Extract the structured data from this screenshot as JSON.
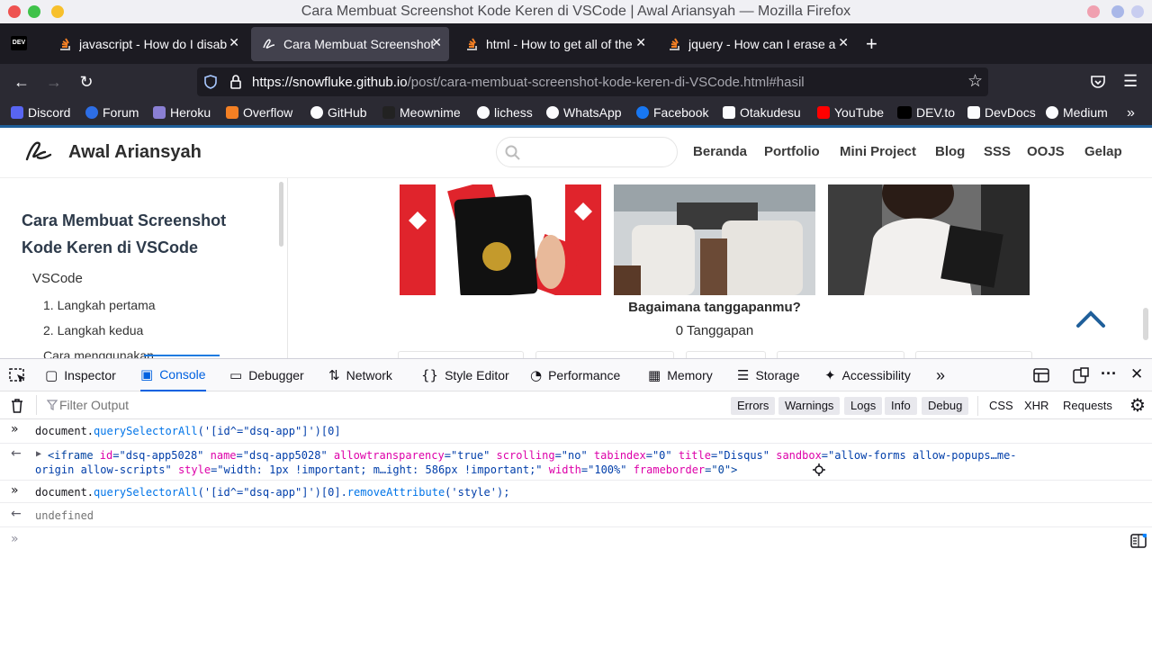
{
  "window": {
    "title": "Cara Membuat Screenshot Kode Keren di VSCode | Awal Ariansyah — Mozilla Firefox"
  },
  "tabs": [
    {
      "label": "javascript - How do I disab",
      "active": false
    },
    {
      "label": "Cara Membuat Screenshot Kod",
      "active": true
    },
    {
      "label": "html - How to get all of the",
      "active": false
    },
    {
      "label": "jquery - How can I erase a",
      "active": false
    }
  ],
  "url": {
    "host": "https://snowfluke.github.io",
    "path": "/post/cara-membuat-screenshot-kode-keren-di-VSCode.html#hasil"
  },
  "bookmarks": [
    "Discord",
    "Forum",
    "Heroku",
    "Overflow",
    "GitHub",
    "Meownime",
    "lichess",
    "WhatsApp",
    "Facebook",
    "Otakudesu",
    "YouTube",
    "DEV.to",
    "DevDocs",
    "Medium"
  ],
  "site": {
    "brand": "Awal Ariansyah",
    "menu": [
      "Beranda",
      "Portfolio",
      "Mini Project",
      "Blog",
      "SSS",
      "OOJS",
      "Gelap"
    ],
    "sidebar": {
      "title": "Cara Membuat Screenshot Kode Keren di VSCode",
      "items": [
        "VSCode",
        "1. Langkah pertama",
        "2. Langkah kedua",
        "Cara menggunakan"
      ]
    },
    "prompt": "Bagaimana tanggapanmu?",
    "responses": "0 Tanggapan"
  },
  "devtools": {
    "tabs": [
      "Inspector",
      "Console",
      "Debugger",
      "Network",
      "Style Editor",
      "Performance",
      "Memory",
      "Storage",
      "Accessibility"
    ],
    "filter_placeholder": "Filter Output",
    "filters": [
      "Errors",
      "Warnings",
      "Logs",
      "Info",
      "Debug"
    ],
    "filters2": [
      "CSS",
      "XHR",
      "Requests"
    ],
    "console": {
      "cmd1_a": "document.",
      "cmd1_b": "querySelectorAll",
      "cmd1_c": "('[id^=\"dsq-app\"]')[0]",
      "out1_a": "<iframe ",
      "out1_b": "id",
      "out1_c": "=\"dsq-app5028\" ",
      "out1_d": "name",
      "out1_e": "=\"dsq-app5028\" ",
      "out1_f": "allowtransparency",
      "out1_g": "=\"true\" ",
      "out1_h": "scrolling",
      "out1_i": "=\"no\" ",
      "out1_j": "tabindex",
      "out1_k": "=\"0\" ",
      "out1_l": "title",
      "out1_m": "=\"Disqus\" ",
      "out1_n": "sandbox",
      "out1_o": "=\"allow-forms allow-popups…me-",
      "out2_a": "origin allow-scripts\" ",
      "out2_b": "style",
      "out2_c": "=\"width: 1px !important; m…ight: 586px !important;\" ",
      "out2_d": "width",
      "out2_e": "=\"100%\" ",
      "out2_f": "frameborder",
      "out2_g": "=\"0\">",
      "cmd2_a": "document.",
      "cmd2_b": "querySelectorAll",
      "cmd2_c": "('[id^=\"dsq-app\"]')[0].",
      "cmd2_d": "removeAttribute",
      "cmd2_e": "('style');",
      "result": "undefined"
    }
  }
}
